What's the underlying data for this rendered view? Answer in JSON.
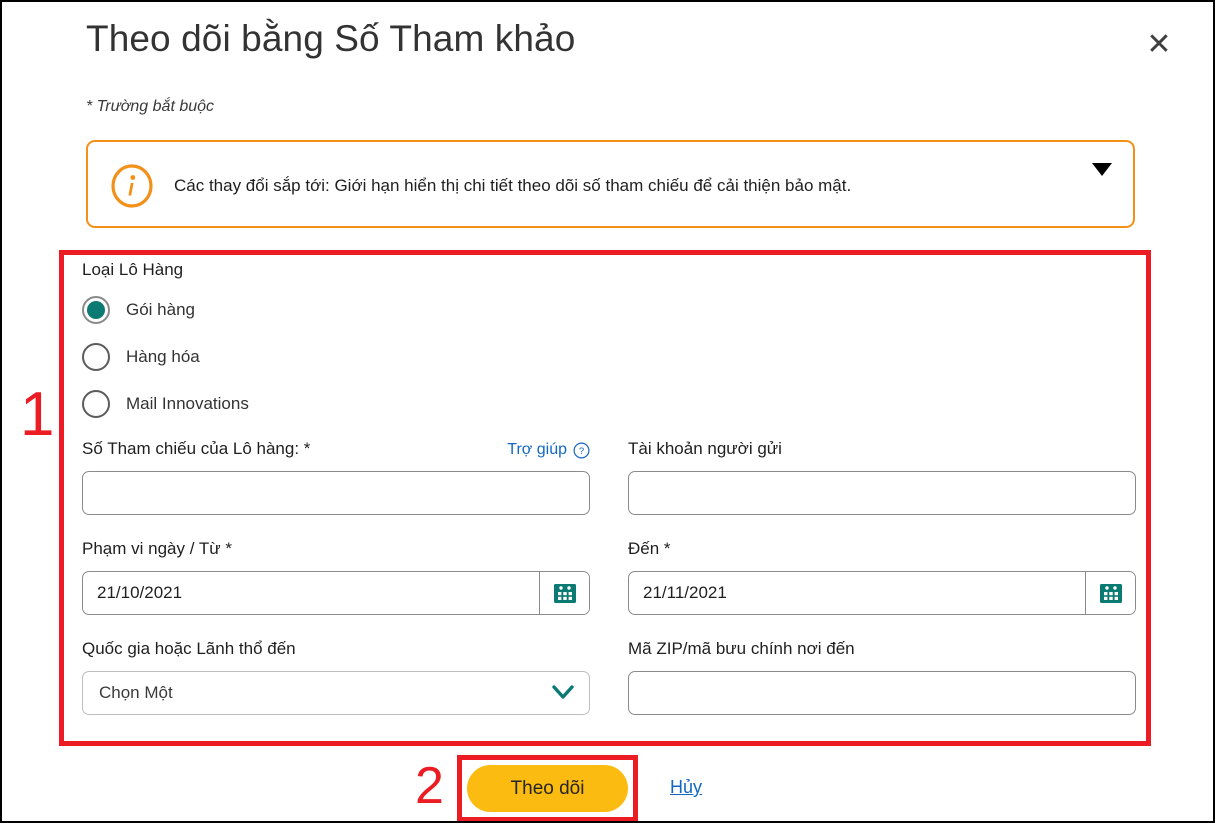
{
  "dialog": {
    "title": "Theo dõi bằng Số Tham khảo",
    "close_icon": "close-icon",
    "required_note": "* Trường bắt buộc"
  },
  "alert": {
    "icon": "info-icon",
    "message": "Các thay đổi sắp tới: Giới hạn hiển thị chi tiết theo dõi số tham chiếu để cải thiện bảo mật.",
    "expand_icon": "chevron-down-icon",
    "border_color": "#f39019"
  },
  "form": {
    "shipment_type": {
      "label": "Loại Lô Hàng",
      "options": [
        {
          "label": "Gói hàng",
          "selected": true
        },
        {
          "label": "Hàng hóa",
          "selected": false
        },
        {
          "label": "Mail Innovations",
          "selected": false
        }
      ],
      "selected_color": "#0b7a72"
    },
    "reference_number": {
      "label": "Số Tham chiếu của Lô hàng: *",
      "value": "",
      "placeholder": "",
      "help_label": "Trợ giúp",
      "help_icon": "question-circle-icon"
    },
    "shipper_account": {
      "label": "Tài khoản người gửi",
      "value": "",
      "placeholder": ""
    },
    "date_from": {
      "label": "Phạm vi ngày / Từ *",
      "value": "21/10/2021",
      "calendar_icon": "calendar-icon"
    },
    "date_to": {
      "label": "Đến *",
      "value": "21/11/2021",
      "calendar_icon": "calendar-icon"
    },
    "destination_country": {
      "label": "Quốc gia hoặc Lãnh thổ đến",
      "value": "Chọn Một",
      "chevron_icon": "chevron-down-icon"
    },
    "destination_zip": {
      "label": "Mã ZIP/mã bưu chính nơi đến",
      "value": "",
      "placeholder": ""
    }
  },
  "footer": {
    "submit_label": "Theo dõi",
    "cancel_label": "Hủy",
    "submit_color": "#fbbb10",
    "link_color": "#1267c4"
  },
  "annotations": {
    "step_one": "1",
    "step_two": "2",
    "color": "#ec1c24"
  }
}
